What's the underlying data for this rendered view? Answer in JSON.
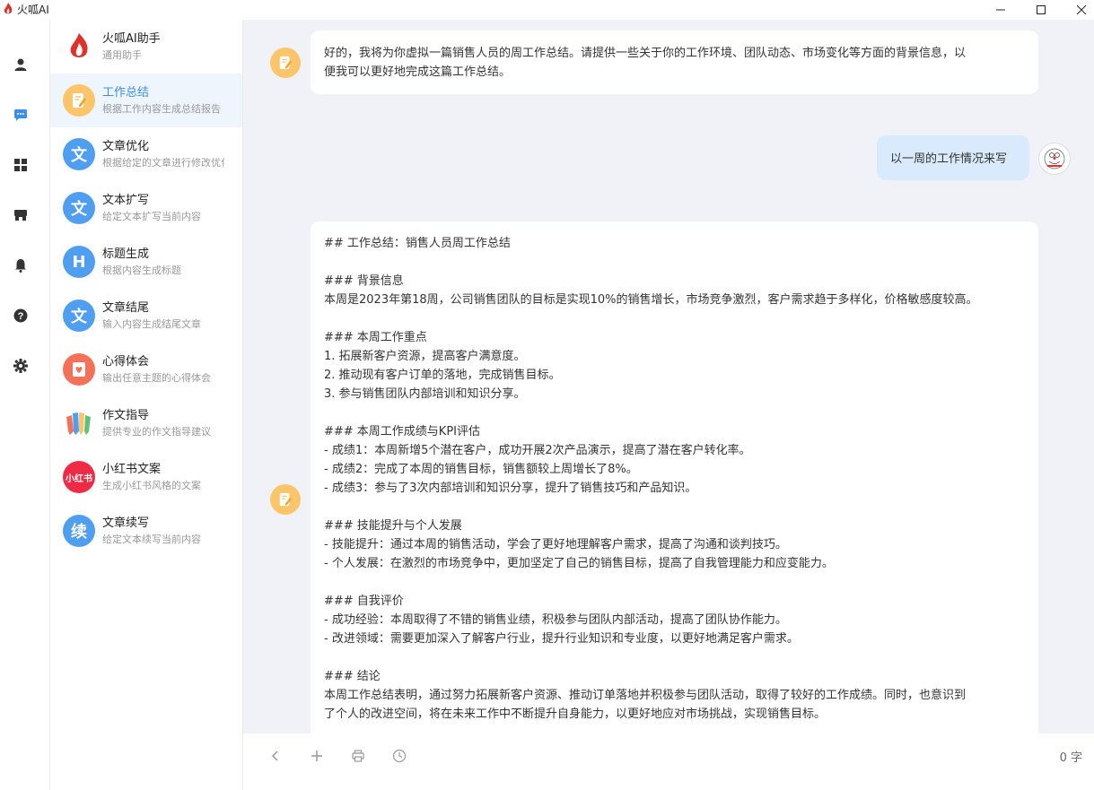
{
  "window": {
    "title": "火呱AI"
  },
  "rail": {
    "items": [
      {
        "name": "user-icon"
      },
      {
        "name": "chat-icon",
        "active": true
      },
      {
        "name": "apps-grid-icon"
      },
      {
        "name": "store-icon"
      },
      {
        "name": "bell-icon"
      },
      {
        "name": "help-icon"
      },
      {
        "name": "gear-icon"
      }
    ]
  },
  "assistants": [
    {
      "name": "火呱AI助手",
      "desc": "通用助手",
      "icon": "flame-logo-icon"
    },
    {
      "name": "工作总结",
      "desc": "根据工作内容生成总结报告",
      "icon": "note-edit-icon",
      "color": "#fcc569",
      "active": true
    },
    {
      "name": "文章优化",
      "desc": "根据给定的文章进行修改优化",
      "icon_text": "文",
      "color": "#4f9ef0"
    },
    {
      "name": "文本扩写",
      "desc": "给定文本扩写当前内容",
      "icon_text": "文",
      "color": "#4f9ef0"
    },
    {
      "name": "标题生成",
      "desc": "根据内容生成标题",
      "icon_text": "H",
      "color": "#4f9ef0"
    },
    {
      "name": "文章结尾",
      "desc": "输入内容生成结尾文章",
      "icon_text": "文",
      "color": "#4f9ef0"
    },
    {
      "name": "心得体会",
      "desc": "输出任意主题的心得体会",
      "icon": "heart-card-icon",
      "color": "#f47158"
    },
    {
      "name": "作文指导",
      "desc": "提供专业的作文指导建议",
      "icon": "pencils-icon"
    },
    {
      "name": "小红书文案",
      "desc": "生成小红书风格的文案",
      "icon_text": "小红书",
      "color": "#ee2a45"
    },
    {
      "name": "文章续写",
      "desc": "给定文本续写当前内容",
      "icon_text": "续",
      "color": "#4f9ef0"
    }
  ],
  "messages": {
    "bot_intro": [
      "好的，我将为你虚拟一篇销售人员的周工作总结。请提供一些关于你的工作环境、团队动态、市场变化等方面的背景信息，以",
      "便我可以更好地完成这篇工作总结。"
    ],
    "user": "以一周的工作情况来写",
    "bot_reply": [
      "## 工作总结：销售人员周工作总结",
      "",
      "### 背景信息",
      "本周是2023年第18周，公司销售团队的目标是实现10%的销售增长，市场竞争激烈，客户需求趋于多样化，价格敏感度较高。",
      "",
      "### 本周工作重点",
      "1. 拓展新客户资源，提高客户满意度。",
      "2. 推动现有客户订单的落地，完成销售目标。",
      "3. 参与销售团队内部培训和知识分享。",
      "",
      "### 本周工作成绩与KPI评估",
      "- 成绩1：本周新增5个潜在客户，成功开展2次产品演示，提高了潜在客户转化率。",
      "- 成绩2：完成了本周的销售目标，销售额较上周增长了8%。",
      "- 成绩3：参与了3次内部培训和知识分享，提升了销售技巧和产品知识。",
      "",
      "### 技能提升与个人发展",
      "- 技能提升：通过本周的销售活动，学会了更好地理解客户需求，提高了沟通和谈判技巧。",
      "- 个人发展：在激烈的市场竞争中，更加坚定了自己的销售目标，提高了自我管理能力和应变能力。",
      "",
      "### 自我评价",
      "- 成功经验：本周取得了不错的销售业绩，积极参与团队内部活动，提高了团队协作能力。",
      "- 改进领域：需要更加深入了解客户行业，提升行业知识和专业度，以更好地满足客户需求。",
      "",
      "### 结论",
      "本周工作总结表明，通过努力拓展新客户资源、推动订单落地并积极参与团队活动，取得了较好的工作成绩。同时，也意识到",
      "了个人的改进空间，将在未来工作中不断提升自身能力，以更好地应对市场挑战，实现销售目标。"
    ]
  },
  "toolbar": {
    "word_count": "0 字",
    "buttons": [
      "chevron-left-icon",
      "plus-icon",
      "printer-icon",
      "clock-icon"
    ]
  },
  "colors": {
    "accent": "#3c8ee8",
    "chat_bg": "#f0f2f7",
    "user_bubble": "#d9eafc",
    "bot_avatar": "#fcc569"
  }
}
